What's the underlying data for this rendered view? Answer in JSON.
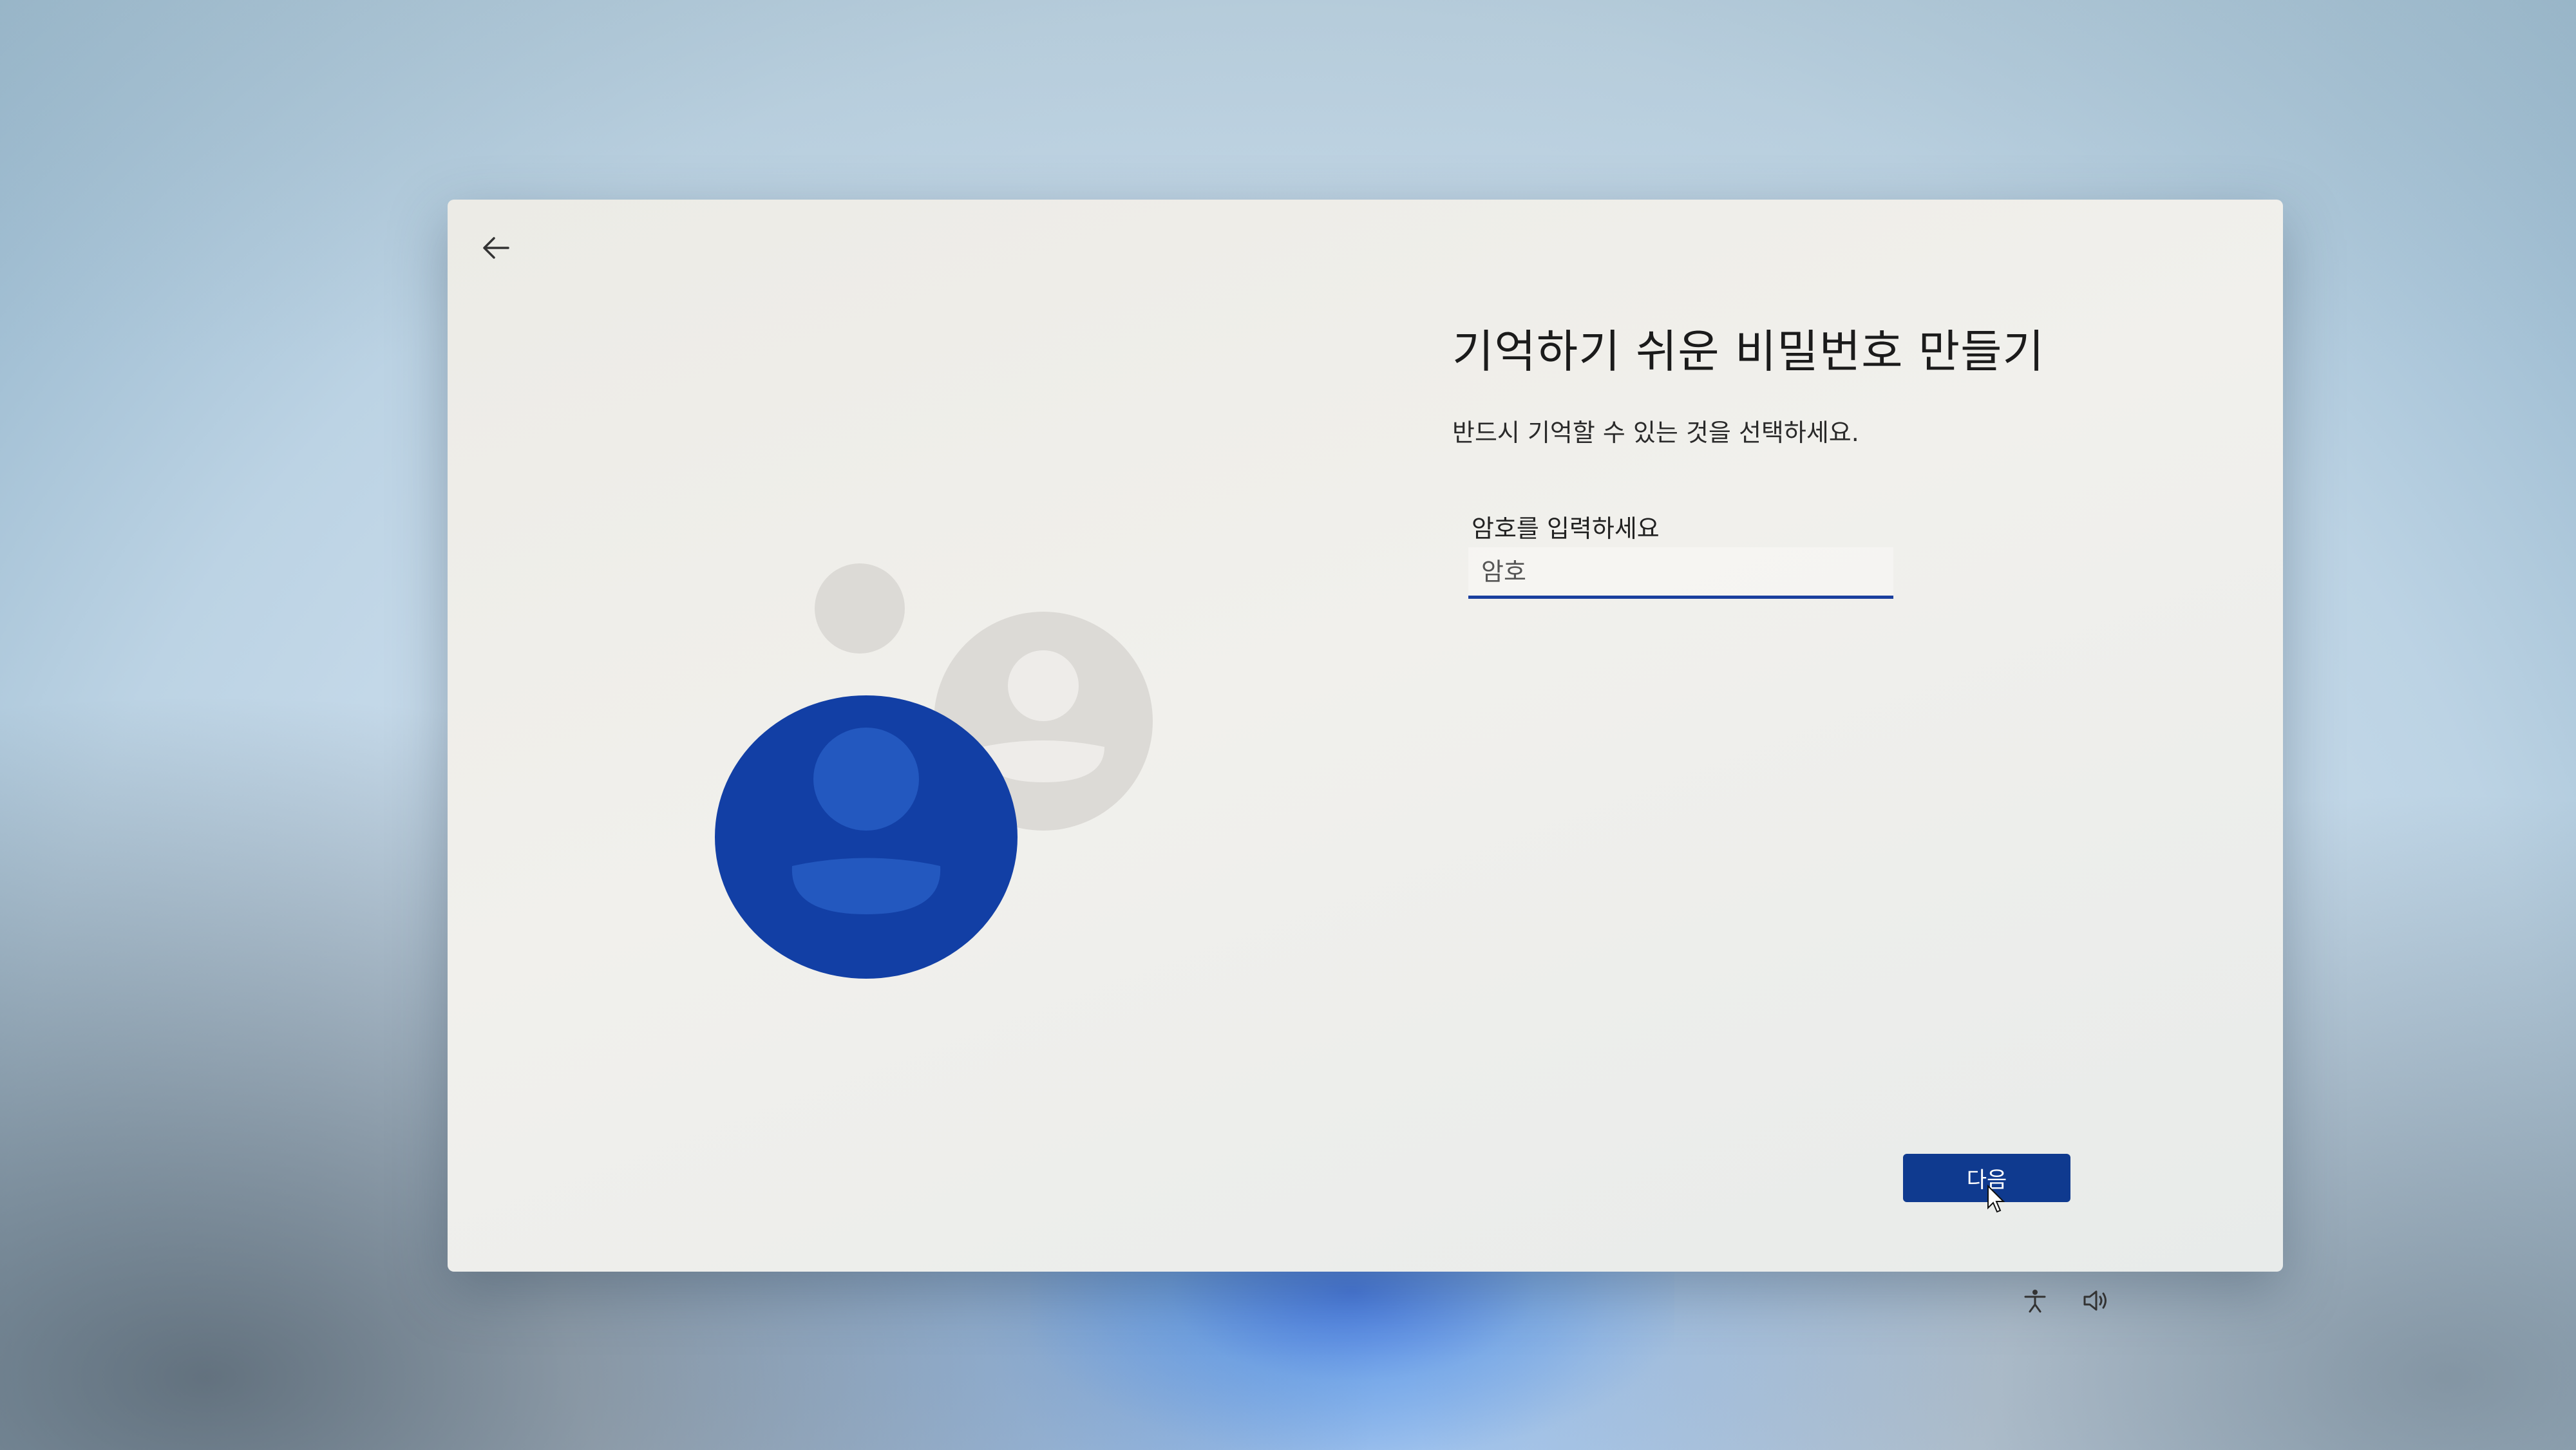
{
  "window": {
    "back_icon": "arrow-left-icon"
  },
  "main": {
    "title": "기억하기 쉬운 비밀번호 만들기",
    "subtitle": "반드시 기억할 수 있는 것을 선택하세요.",
    "password_label": "암호를 입력하세요",
    "password_placeholder": "암호",
    "password_value": ""
  },
  "footer": {
    "next_label": "다음"
  },
  "tray": {
    "accessibility_icon": "accessibility-icon",
    "volume_icon": "volume-icon"
  },
  "colors": {
    "accent": "#0f3a8f",
    "avatar_blue": "#123fa5",
    "avatar_gray": "#d9d7d3"
  }
}
